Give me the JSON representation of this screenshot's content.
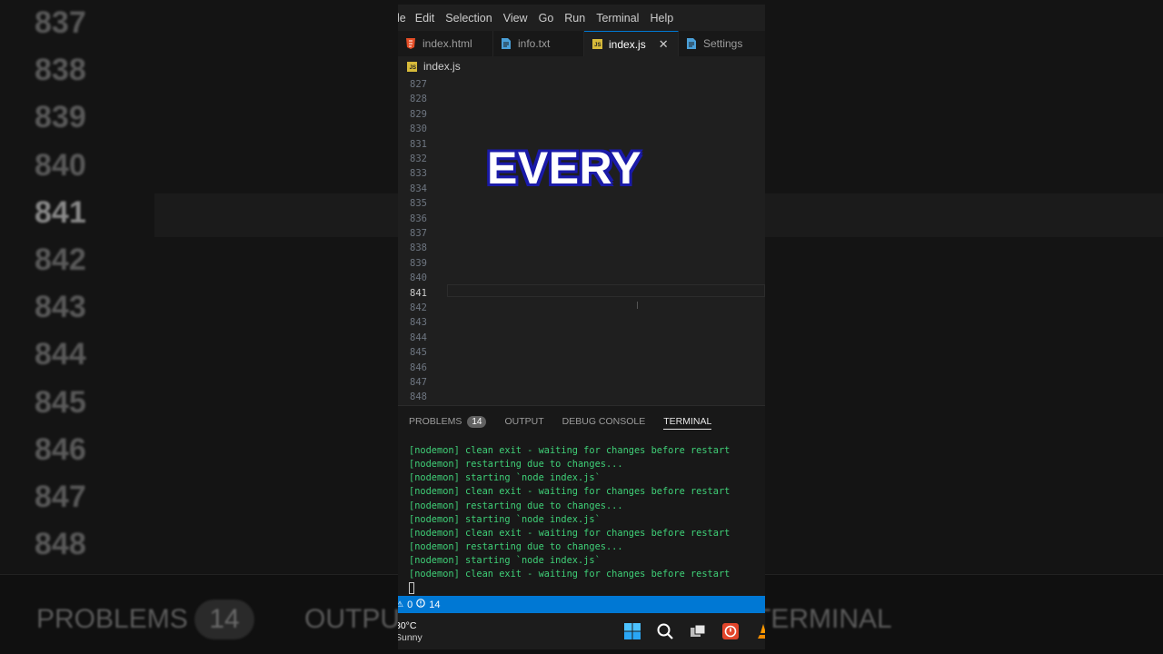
{
  "background": {
    "line_numbers": [
      "837",
      "838",
      "839",
      "840",
      "841",
      "842",
      "843",
      "844",
      "845",
      "846",
      "847",
      "848"
    ],
    "active_line": "841",
    "panel_labels": {
      "problems": "PROBLEMS",
      "badge": "14",
      "output": "OUTPUT",
      "terminal": "TERMINAL"
    }
  },
  "menubar": {
    "items": [
      "le",
      "Edit",
      "Selection",
      "View",
      "Go",
      "Run",
      "Terminal",
      "Help"
    ]
  },
  "tabs": [
    {
      "label": "index.html",
      "icon": "html-file-icon",
      "color": "#e44d26"
    },
    {
      "label": "info.txt",
      "icon": "text-file-icon",
      "color": "#4a9fd8"
    },
    {
      "label": "index.js",
      "icon": "js-file-icon",
      "color": "#d7ba3a",
      "active": true
    },
    {
      "label": "Settings",
      "icon": "settings-file-icon",
      "color": "#4a9fd8"
    }
  ],
  "breadcrumb": {
    "file": "index.js",
    "icon_text": "JS"
  },
  "editor": {
    "line_numbers": [
      "827",
      "828",
      "829",
      "830",
      "831",
      "832",
      "833",
      "834",
      "835",
      "836",
      "837",
      "838",
      "839",
      "840",
      "841",
      "842",
      "843",
      "844",
      "845",
      "846",
      "847",
      "848"
    ],
    "active_line": "841"
  },
  "caption": "EVERY",
  "panel": {
    "tabs": [
      {
        "label": "PROBLEMS",
        "badge": "14"
      },
      {
        "label": "OUTPUT"
      },
      {
        "label": "DEBUG CONSOLE"
      },
      {
        "label": "TERMINAL",
        "active": true
      }
    ],
    "terminal_lines": [
      "[nodemon] clean exit - waiting for changes before restart",
      "[nodemon] restarting due to changes...",
      "[nodemon] starting `node index.js`",
      "[nodemon] clean exit - waiting for changes before restart",
      "[nodemon] restarting due to changes...",
      "[nodemon] starting `node index.js`",
      "[nodemon] clean exit - waiting for changes before restart",
      "[nodemon] restarting due to changes...",
      "[nodemon] starting `node index.js`",
      "[nodemon] clean exit - waiting for changes before restart"
    ]
  },
  "statusbar": {
    "errors": "0",
    "warnings": "14"
  },
  "taskbar": {
    "temperature": "30°C",
    "condition": "Sunny",
    "icons": [
      "windows-start-icon",
      "search-icon",
      "task-view-icon",
      "app-red-icon",
      "vlc-icon"
    ]
  },
  "colors": {
    "accent": "#0078d4",
    "terminal_text": "#3fcf77",
    "caption_outline": "#1a1aa8"
  }
}
